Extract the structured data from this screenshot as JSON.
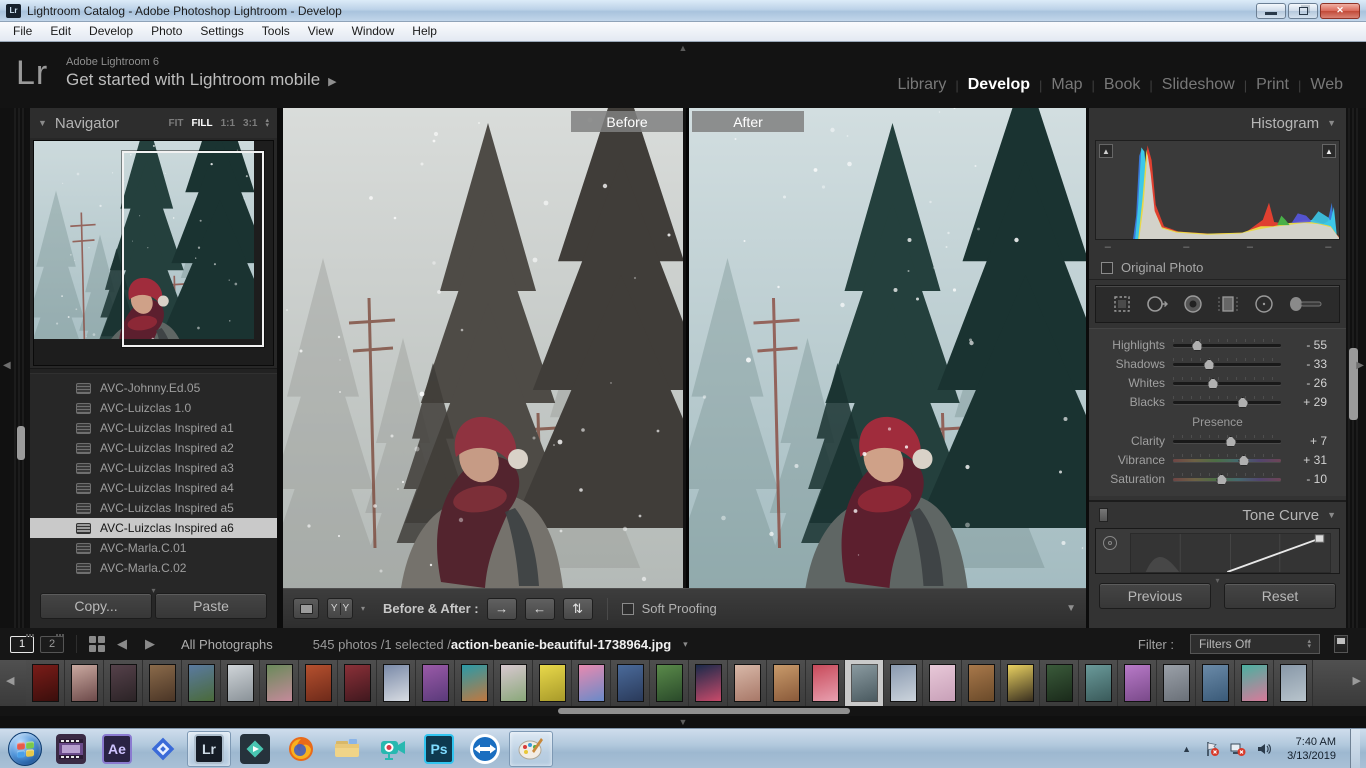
{
  "window": {
    "title": "Lightroom Catalog - Adobe Photoshop Lightroom - Develop",
    "logo": "Lr"
  },
  "menu": {
    "items": [
      "File",
      "Edit",
      "Develop",
      "Photo",
      "Settings",
      "Tools",
      "View",
      "Window",
      "Help"
    ]
  },
  "header": {
    "logo": "Lr",
    "app_name": "Adobe Lightroom 6",
    "tagline": "Get started with Lightroom mobile",
    "tagline_arrow": "▶"
  },
  "modules": {
    "items": [
      "Library",
      "Develop",
      "Map",
      "Book",
      "Slideshow",
      "Print",
      "Web"
    ],
    "active": "Develop"
  },
  "navigator": {
    "title": "Navigator",
    "zoom_levels": [
      "FIT",
      "FILL",
      "1:1",
      "3:1"
    ],
    "active_zoom": "FILL"
  },
  "presets": {
    "items": [
      "AVC-Johnny.Ed.05",
      "AVC-Luizclas 1.0",
      "AVC-Luizclas Inspired a1",
      "AVC-Luizclas Inspired a2",
      "AVC-Luizclas Inspired a3",
      "AVC-Luizclas Inspired a4",
      "AVC-Luizclas Inspired a5",
      "AVC-Luizclas Inspired a6",
      "AVC-Marla.C.01",
      "AVC-Marla.C.02"
    ],
    "selected_index": 7
  },
  "left_buttons": {
    "copy": "Copy...",
    "paste": "Paste"
  },
  "view": {
    "before_label": "Before",
    "after_label": "After"
  },
  "toolbar": {
    "yy_label": "YY",
    "before_after_label": "Before & After :",
    "soft_proofing_label": "Soft Proofing"
  },
  "histogram": {
    "title": "Histogram",
    "original_photo_label": "Original Photo",
    "dash": "–"
  },
  "adjustments": {
    "sliders": [
      {
        "label": "Highlights",
        "value": -55,
        "display": "- 55"
      },
      {
        "label": "Shadows",
        "value": -33,
        "display": "- 33"
      },
      {
        "label": "Whites",
        "value": -26,
        "display": "- 26"
      },
      {
        "label": "Blacks",
        "value": 29,
        "display": "+ 29"
      }
    ],
    "presence_title": "Presence",
    "presence_sliders": [
      {
        "label": "Clarity",
        "value": 7,
        "display": "+ 7"
      },
      {
        "label": "Vibrance",
        "value": 31,
        "display": "+ 31"
      },
      {
        "label": "Saturation",
        "value": -10,
        "display": "- 10"
      }
    ]
  },
  "tone_curve": {
    "title": "Tone Curve"
  },
  "right_buttons": {
    "previous": "Previous",
    "reset": "Reset"
  },
  "filmstrip_bar": {
    "monitors": [
      "1",
      "2"
    ],
    "source": "All Photographs",
    "status": "545 photos /1 selected /",
    "filename": "action-beanie-beautiful-1738964.jpg",
    "filter_label": "Filter :",
    "filter_value": "Filters Off"
  },
  "filmstrip": {
    "selected_index": 21,
    "thumb_colors": [
      [
        "#7a1c18",
        "#3a0e0c"
      ],
      [
        "#caa9a0",
        "#6d4a4a"
      ],
      [
        "#55414a",
        "#2b2326"
      ],
      [
        "#8a6a4a",
        "#4a3526"
      ],
      [
        "#5a7aa0",
        "#4a6a3a"
      ],
      [
        "#cfd4d8",
        "#8a9298"
      ],
      [
        "#6a8a5a",
        "#c48a9a"
      ],
      [
        "#b5502e",
        "#6e2a1a"
      ],
      [
        "#8a3038",
        "#40181e"
      ],
      [
        "#7a8aa8",
        "#d8dce2"
      ],
      [
        "#9a5aa8",
        "#5a3a7a"
      ],
      [
        "#2a9aa8",
        "#c07840"
      ],
      [
        "#d8c8d0",
        "#8aa87a"
      ],
      [
        "#e8d84a",
        "#a89a2a"
      ],
      [
        "#e88ab0",
        "#6a8ac8"
      ],
      [
        "#4a6a9a",
        "#2a3a5a"
      ],
      [
        "#5a8a4a",
        "#2a4a2a"
      ],
      [
        "#1a2a4a",
        "#c84a6a"
      ],
      [
        "#d8b8a8",
        "#a87868"
      ],
      [
        "#c89a6a",
        "#8a5a3a"
      ],
      [
        "#c84a5a",
        "#e8a0b0"
      ],
      [
        "#8a9aa0",
        "#4a5a60"
      ],
      [
        "#8a9ab0",
        "#ccd4dc"
      ],
      [
        "#e8c8d8",
        "#c8a0b8"
      ],
      [
        "#a8784a",
        "#6a4a2a"
      ],
      [
        "#e8d060",
        "#3a3020"
      ],
      [
        "#3a5a3a",
        "#1a2a1a"
      ],
      [
        "#6a9a9a",
        "#3a5a5a"
      ],
      [
        "#b87ac8",
        "#7a4a8a"
      ],
      [
        "#9aa0a8",
        "#6a7078"
      ],
      [
        "#6a8aa8",
        "#3a5a78"
      ],
      [
        "#4ab0a0",
        "#d87a9a"
      ],
      [
        "#8898a8",
        "#b8c4cc"
      ]
    ]
  },
  "taskbar": {
    "apps": [
      {
        "icon": "movie-maker-icon",
        "active": false
      },
      {
        "icon": "after-effects-icon",
        "label": "Ae",
        "active": false
      },
      {
        "icon": "diamond-app-icon",
        "active": false
      },
      {
        "icon": "lightroom-icon",
        "label": "Lr",
        "active": true
      },
      {
        "icon": "filmora-icon",
        "active": false
      },
      {
        "icon": "firefox-icon",
        "active": false
      },
      {
        "icon": "explorer-icon",
        "active": false
      },
      {
        "icon": "screen-recorder-icon",
        "active": false
      },
      {
        "icon": "photoshop-icon",
        "label": "Ps",
        "active": false
      },
      {
        "icon": "teamviewer-icon",
        "active": false
      },
      {
        "icon": "paint-app-icon",
        "active": true
      }
    ],
    "clock": {
      "time": "7:40 AM",
      "date": "3/13/2019"
    }
  },
  "icons": {
    "caret_down": "▼",
    "caret_up": "▲",
    "caret_down_small": "▾",
    "caret_up_small": "▴",
    "arrow_left": "◀",
    "arrow_right": "▶",
    "ba_copy_right": "→",
    "ba_copy_left": "←",
    "ba_swap": "⇅"
  },
  "scene": {
    "before": {
      "sky_top": "#d9dcda",
      "sky_bottom": "#b4bab7",
      "far": "#8f918d",
      "tree": "#4e4b46",
      "tree2": "#403d39",
      "pole": "#7d4a3c",
      "coat": "#75726c",
      "beanie": "#8f3340",
      "hair": "#53242e",
      "skin": "#c69b85",
      "scarf": "#7c2f38"
    },
    "after": {
      "sky_top": "#d2dee0",
      "sky_bottom": "#a4bcc1",
      "far": "#6f8a89",
      "tree": "#24403d",
      "tree2": "#1a3331",
      "pole": "#8a4a3f",
      "coat": "#5f6664",
      "beanie": "#a02c3c",
      "hair": "#5c1f2e",
      "skin": "#cfa188",
      "scarf": "#8c2836"
    }
  }
}
